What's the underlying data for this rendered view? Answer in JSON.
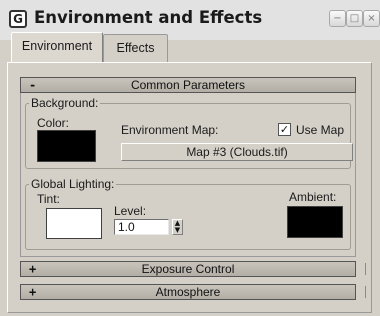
{
  "window": {
    "title": "Environment and Effects",
    "app_icon": "3ds-max-app-icon",
    "title_buttons": [
      "minimize-icon",
      "maximize-icon",
      "close-icon"
    ]
  },
  "tabs": [
    {
      "label": "Environment",
      "active": true
    },
    {
      "label": "Effects",
      "active": false
    }
  ],
  "common_parameters": {
    "toggle": "-",
    "title": "Common Parameters",
    "background": {
      "group_label": "Background:",
      "color_label": "Color:",
      "color": "#000000",
      "environment_map_label": "Environment Map:",
      "use_map_checked": true,
      "use_map_label": "Use Map",
      "map_button": "Map #3 (Clouds.tif)"
    },
    "global_lighting": {
      "group_label": "Global Lighting:",
      "tint_label": "Tint:",
      "tint_color": "#ffffff",
      "level_label": "Level:",
      "level_value": "1.0",
      "ambient_label": "Ambient:",
      "ambient_color": "#000000"
    }
  },
  "rollouts": [
    {
      "toggle": "+",
      "title": "Exposure Control"
    },
    {
      "toggle": "+",
      "title": "Atmosphere"
    }
  ]
}
